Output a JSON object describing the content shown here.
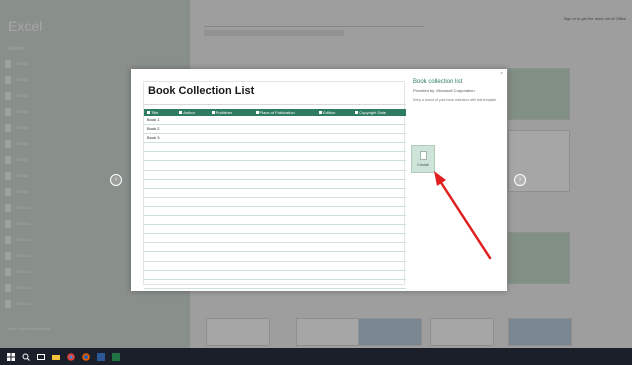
{
  "excel": {
    "brand": "Excel",
    "recent_title": "Recent",
    "recent_items": [
      "Book1",
      "Book2",
      "Book3",
      "Book4",
      "Book5",
      "Book6",
      "Book7",
      "Book8",
      "Book9",
      "Book10",
      "Book11",
      "Book12",
      "Book13",
      "Book14",
      "Book15",
      "Book16"
    ],
    "open_other": "Open Other Workbooks",
    "sign_in": "Sign in to get the most out of Office"
  },
  "dialog": {
    "sheet_title": "Book Collection List",
    "columns": [
      "Title",
      "Author",
      "Publisher",
      "Place of Publication",
      "Edition",
      "Copyright Date"
    ],
    "rows": [
      "Book 1",
      "Book 2",
      "Book 3",
      "",
      "",
      "",
      "",
      "",
      "",
      "",
      "",
      "",
      "",
      "",
      "",
      "",
      "",
      "",
      ""
    ],
    "info_title": "Book collection list",
    "info_provider": "Provided by: Microsoft Corporation",
    "info_description": "Keep a record of your book collection with this template.",
    "create_label": "Create",
    "close_glyph": "×"
  },
  "colors": {
    "accent": "#2f7c63",
    "annotation": "#e02020"
  },
  "icons": {
    "create": "document-icon",
    "nav_left": "chevron-left-icon",
    "nav_right": "chevron-right-icon"
  }
}
